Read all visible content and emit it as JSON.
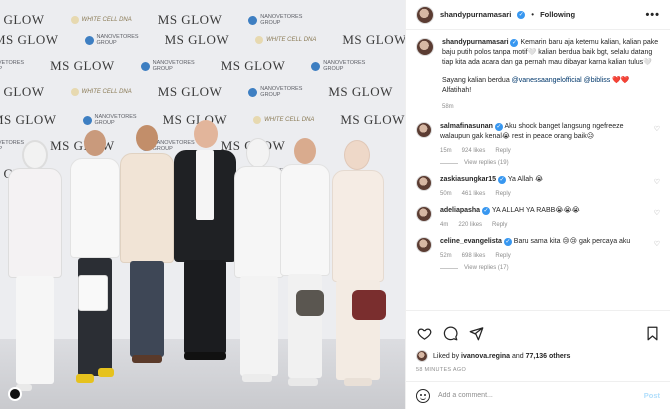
{
  "photo": {
    "backdrop": {
      "brand": "MS GLOW",
      "sponsor_line1": "NANOVETORES",
      "sponsor_line2": "GROUP",
      "product": "WHITE CELL DNA"
    },
    "colors": {
      "backdrop": "#ecedf0",
      "floor": "#d0d1d5"
    }
  },
  "header": {
    "username": "shandypurnamasari",
    "separator": "•",
    "follow_label": "Following",
    "more_label": "•••"
  },
  "caption": {
    "username": "shandypurnamasari",
    "text1": "Kemarin baru aja ketemu kalian, kalian pake baju putih polos tanpa motif🤍 kalian berdua baik bgt, selalu datang tiap kita ada acara dan ga pernah mau dibayar karna kalian tulus🤍",
    "text2_prefix": "Sayang kalian berdua ",
    "mention1": "@vanessaangelofficial",
    "mention2": "@bibliss",
    "hearts": "❤️❤️",
    "text3": "Alfatihah!",
    "time": "58m"
  },
  "comments": [
    {
      "username": "salmafinasunan",
      "text": "Aku shock banget langsung ngefreeze walaupun gak kenal😭 rest in peace orang baik😥",
      "time": "15m",
      "likes": "924 likes",
      "reply_label": "Reply",
      "view_replies": "View replies (19)"
    },
    {
      "username": "zaskiasungkar15",
      "text": "Ya Allah 😭",
      "time": "50m",
      "likes": "461 likes",
      "reply_label": "Reply",
      "view_replies": ""
    },
    {
      "username": "adeliapasha",
      "text": "YA ALLAH YA RABB😭😭😭",
      "time": "4m",
      "likes": "220 likes",
      "reply_label": "Reply",
      "view_replies": ""
    },
    {
      "username": "celine_evangelista",
      "text": "Baru sama kita 😢😢 gak percaya aku",
      "time": "52m",
      "likes": "698 likes",
      "reply_label": "Reply",
      "view_replies": "View replies (17)"
    }
  ],
  "likes": {
    "prefix": "Liked by ",
    "user": "ivanova.regina",
    "middle": " and ",
    "count": "77,136 others"
  },
  "time_ago": "58 MINUTES AGO",
  "add_comment": {
    "placeholder": "Add a comment...",
    "post_label": "Post"
  },
  "icons": {
    "like": "heart-icon",
    "comment": "comment-icon",
    "share": "share-icon",
    "save": "bookmark-icon",
    "emoji": "smiley-icon",
    "more": "more-icon"
  },
  "colors": {
    "link": "#00376b",
    "verified": "#3897f0",
    "muted": "#8e8e8e",
    "post_disabled": "#b2dffc",
    "heart_red": "#ed4956"
  }
}
